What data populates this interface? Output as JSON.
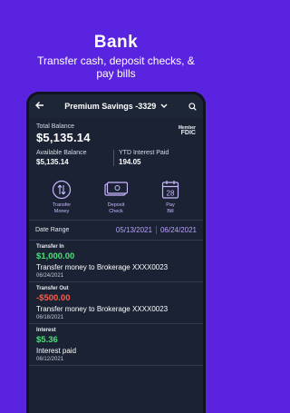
{
  "promo": {
    "title": "Bank",
    "subtitle": "Transfer cash, deposit checks, & pay bills"
  },
  "appbar": {
    "title": "Premium Savings -3329",
    "back_icon": "arrow-left-icon",
    "search_icon": "search-icon"
  },
  "balance": {
    "total_label": "Total Balance",
    "total_value": "$5,135.14",
    "fdic_line1": "Member",
    "fdic_line2": "FDIC",
    "available_label": "Available Balance",
    "available_value": "$5,135.14",
    "ytd_label": "YTD Interest Paid",
    "ytd_value": "194.05"
  },
  "actions": [
    {
      "label_line1": "Transfer",
      "label_line2": "Money",
      "icon": "transfer-icon"
    },
    {
      "label_line1": "Deposit",
      "label_line2": "Check",
      "icon": "check-icon"
    },
    {
      "label_line1": "Pay",
      "label_line2": "Bill",
      "icon": "calendar-icon"
    }
  ],
  "date_range": {
    "label": "Date Range",
    "start": "05/13/2021",
    "end": "06/24/2021"
  },
  "transactions": [
    {
      "type": "Transfer In",
      "amount": "$1,000.00",
      "direction": "positive",
      "description": "Transfer money to Brokerage XXXX0023",
      "date": "06/24/2021"
    },
    {
      "type": "Transfer Out",
      "amount": "-$500.00",
      "direction": "negative",
      "description": "Transfer money to Brokerage XXXX0023",
      "date": "06/18/2021"
    },
    {
      "type": "Interest",
      "amount": "$5.36",
      "direction": "positive",
      "description": "Interest paid",
      "date": "06/12/2021"
    }
  ],
  "colors": {
    "background": "#5a23e0",
    "card": "#1a2233",
    "accent": "#b9a2ff",
    "positive": "#4ce07a",
    "negative": "#ff5a4a"
  }
}
